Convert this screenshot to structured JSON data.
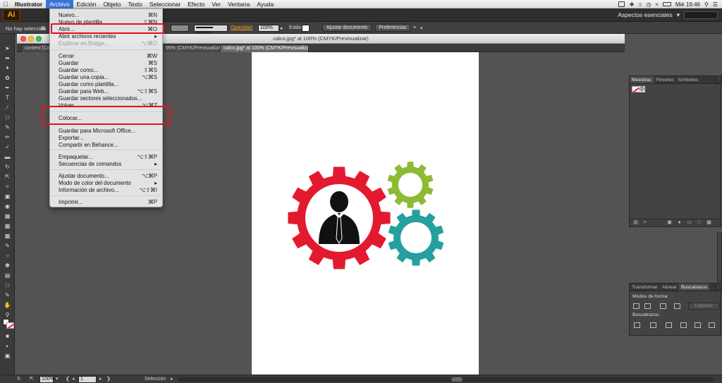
{
  "mac_menubar": {
    "apple": "",
    "items": [
      "Illustrator",
      "Archivo",
      "Edición",
      "Objeto",
      "Texto",
      "Seleccionar",
      "Efecto",
      "Ver",
      "Ventana",
      "Ayuda"
    ],
    "active_item": "Archivo",
    "clock": "Mié 19:46"
  },
  "app_bar": {
    "logo": "Ai",
    "workspace_label": "Aspectos esenciales",
    "workspace_chevron": "▾"
  },
  "control_bar": {
    "selection_status": "No hay selección",
    "stroke_style": "Básico",
    "opacity_label": "Opacidad:",
    "opacity_value": "100%",
    "style_label": "Estilo:",
    "adjust_document": "Ajustar documento",
    "preferences": "Preferencias"
  },
  "document": {
    "window_title": "calco.jpg* al 100% (CMYK/Previsualizar)",
    "tabs": [
      {
        "label": "content [Con"
      },
      {
        "label": "95% (CMYK/Previsualizar)"
      },
      {
        "label": "calco.jpg* al 100% (CMYK/Previsualizar)"
      }
    ],
    "active_tab": 2
  },
  "file_menu": {
    "groups": [
      [
        {
          "label": "Nuevo...",
          "shortcut": "⌘N"
        },
        {
          "label": "Nuevo de plantilla...",
          "shortcut": "⇧⌘N"
        },
        {
          "label": "Abrir...",
          "shortcut": "⌘O"
        },
        {
          "label": "Abrir archivos recientes",
          "shortcut": "▸"
        },
        {
          "label": "Explorar en Bridge...",
          "shortcut": "⌥⌘O",
          "disabled": true
        }
      ],
      [
        {
          "label": "Cerrar",
          "shortcut": "⌘W"
        },
        {
          "label": "Guardar",
          "shortcut": "⌘S"
        },
        {
          "label": "Guardar como...",
          "shortcut": "⇧⌘S"
        },
        {
          "label": "Guardar una copia...",
          "shortcut": "⌥⌘S"
        },
        {
          "label": "Guardar como plantilla...",
          "shortcut": ""
        },
        {
          "label": "Guardar para Web...",
          "shortcut": "⌥⇧⌘S"
        },
        {
          "label": "Guardar sectores seleccionados...",
          "shortcut": ""
        },
        {
          "label": "Volver",
          "shortcut": "⌥⌘Z"
        }
      ],
      [
        {
          "label": "Colocar...",
          "shortcut": ""
        }
      ],
      [
        {
          "label": "Guardar para Microsoft Office...",
          "shortcut": ""
        },
        {
          "label": "Exportar...",
          "shortcut": ""
        },
        {
          "label": "Compartir en Behance...",
          "shortcut": ""
        }
      ],
      [
        {
          "label": "Empaquetar...",
          "shortcut": "⌥⇧⌘P"
        },
        {
          "label": "Secuencias de comandos",
          "shortcut": "▸"
        }
      ],
      [
        {
          "label": "Ajustar documento...",
          "shortcut": "⌥⌘P"
        },
        {
          "label": "Modo de color del documento",
          "shortcut": "▸"
        },
        {
          "label": "Información de archivo...",
          "shortcut": "⌥⇧⌘I"
        }
      ],
      [
        {
          "label": "Imprimir...",
          "shortcut": "⌘P"
        }
      ]
    ],
    "highlighted": [
      "Abrir...",
      "Colocar..."
    ]
  },
  "swatches_panel": {
    "tabs": [
      "Muestras",
      "Pinceles",
      "Símbolos"
    ],
    "active_tab": "Muestras"
  },
  "pathfinder_panel": {
    "tabs": [
      "Transformar",
      "Alinear",
      "Buscatrazos"
    ],
    "active_tab": "Buscatrazos",
    "shape_modes_label": "Modos de forma:",
    "expand_button": "Expandir",
    "pathfinders_label": "Buscatrazos:"
  },
  "status_bar": {
    "zoom": "100%",
    "artboard_number": "1",
    "tool_status": "Selección"
  },
  "artwork": {
    "gear_colors": {
      "large": "#e31a2f",
      "small_top": "#8dbb35",
      "small_bottom": "#25a09f"
    },
    "person_color": "#111111"
  },
  "colors": {
    "menu_active": "#3a73d8",
    "highlight_box": "#e5101c",
    "opacity_label": "#f5a623"
  }
}
